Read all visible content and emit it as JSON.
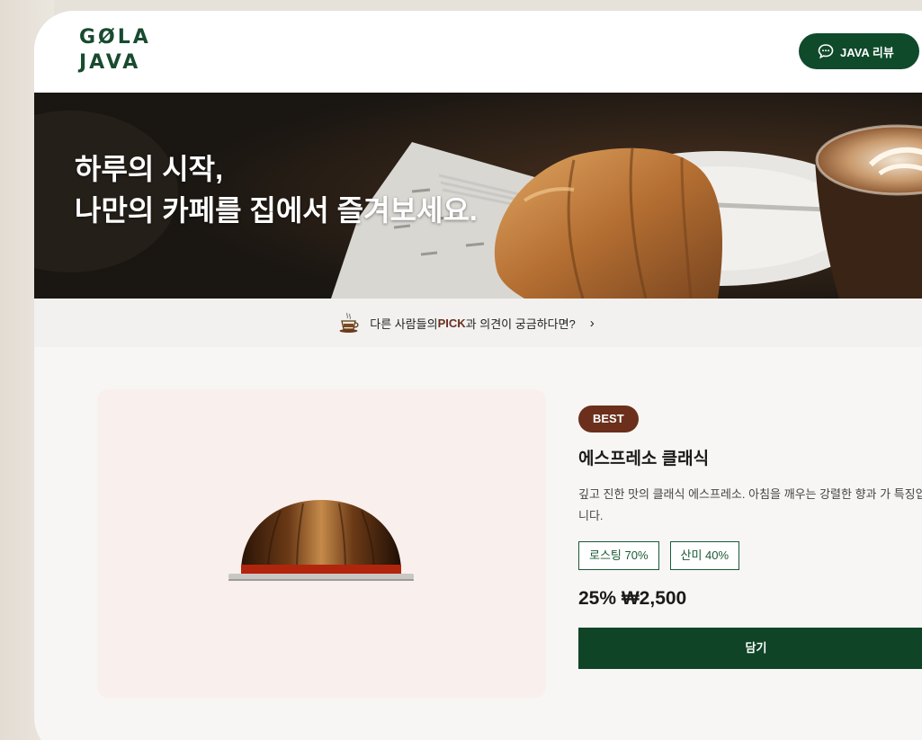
{
  "brand": {
    "logo_line1": "GØLA",
    "logo_line2": "JAVA"
  },
  "header": {
    "review_button": "JAVA 리뷰",
    "review_icon": "chat-bubble-icon"
  },
  "hero": {
    "line1": "하루의 시작,",
    "line2": "나만의 카페를 집에서 즐겨보세요."
  },
  "pick_bar": {
    "icon": "coffee-cup-icon",
    "text_before": "다른 사람들의 ",
    "highlight": "PICK",
    "text_after": "과 의견이 궁금하다면?",
    "chevron": "›"
  },
  "product": {
    "badge": "BEST",
    "name": "에스프레소 클래식",
    "description": "깊고 진한 맛의 클래식 에스프레소. 아침을 깨우는 강렬한 향과 가 특징입니다.",
    "tags": [
      "로스팅 70%",
      "산미 40%"
    ],
    "price": "25% ₩2,500",
    "add_button": "담기"
  },
  "colors": {
    "brand_green": "#0f4a2b",
    "accent_brown": "#6b2f1b",
    "card_bg": "#f9f0ed"
  }
}
